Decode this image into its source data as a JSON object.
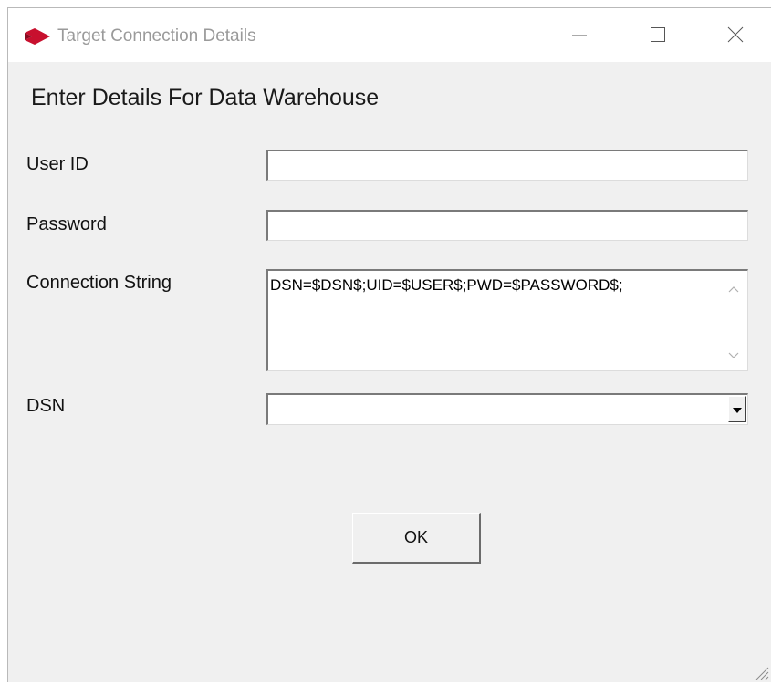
{
  "window": {
    "title": "Target Connection Details",
    "icon": "app-logo-icon",
    "controls": [
      "minimize-icon",
      "maximize-icon",
      "close-icon"
    ],
    "accent_color": "#c8102e"
  },
  "form": {
    "heading": "Enter Details For Data Warehouse",
    "user_id": {
      "label": "User ID",
      "value": ""
    },
    "password": {
      "label": "Password",
      "value": ""
    },
    "connection_string": {
      "label": "Connection String",
      "value": "DSN=$DSN$;UID=$USER$;PWD=$PASSWORD$;"
    },
    "dsn": {
      "label": "DSN",
      "selected": ""
    }
  },
  "actions": {
    "ok_label": "OK"
  }
}
